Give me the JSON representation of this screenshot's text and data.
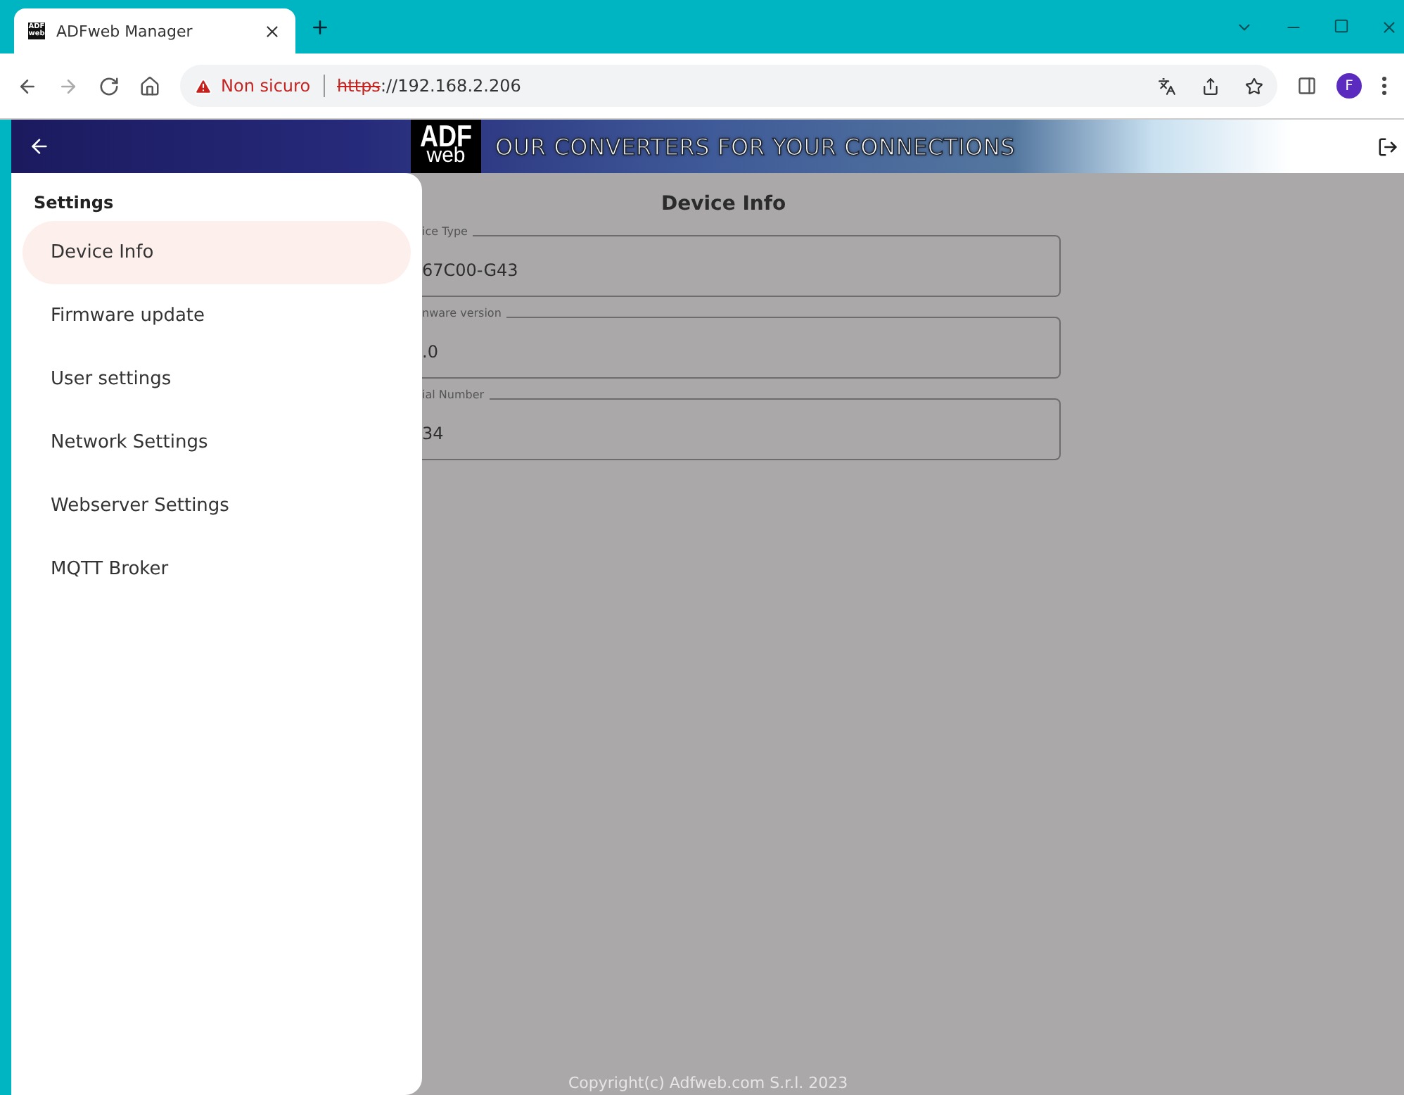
{
  "browser": {
    "tab": {
      "title": "ADFweb Manager",
      "favicon": "ADF web"
    },
    "security": "Non sicuro",
    "url_scheme": "https",
    "url_rest": "://192.168.2.206",
    "profile": "F"
  },
  "header": {
    "logo_top": "ADF",
    "logo_bottom": "web",
    "slogan": "OUR CONVERTERS FOR YOUR CONNECTIONS"
  },
  "drawer": {
    "title": "Settings",
    "items": [
      {
        "label": "Device Info",
        "selected": true
      },
      {
        "label": "Firmware update",
        "selected": false
      },
      {
        "label": "User settings",
        "selected": false
      },
      {
        "label": "Network Settings",
        "selected": false
      },
      {
        "label": "Webserver Settings",
        "selected": false
      },
      {
        "label": "MQTT Broker",
        "selected": false
      }
    ]
  },
  "page": {
    "title": "Device Info",
    "fields": [
      {
        "label": "ice Type",
        "value": "67C00-G43"
      },
      {
        "label": "nware version",
        "value": ".0"
      },
      {
        "label": "ial Number",
        "value": "34"
      }
    ],
    "footer": "Copyright(c) Adfweb.com S.r.l. 2023"
  }
}
